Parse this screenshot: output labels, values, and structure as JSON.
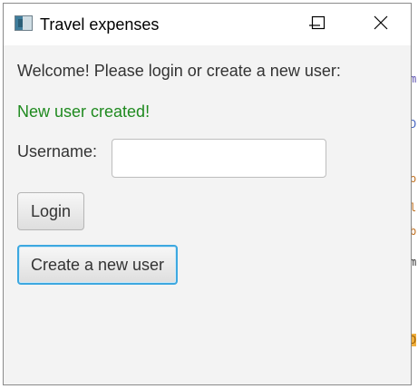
{
  "window": {
    "title": "Travel expenses"
  },
  "content": {
    "welcome_text": "Welcome! Please login or create a new user:",
    "status_text": "New user created!",
    "username_label": "Username:",
    "username_value": "",
    "login_label": "Login",
    "create_user_label": "Create a new user"
  },
  "colors": {
    "status_text": "#1f8a1f",
    "focus_ring": "#3da8e0"
  },
  "background_fragments": [
    "m",
    "D",
    "o",
    "l",
    "b",
    "m",
    "D"
  ]
}
